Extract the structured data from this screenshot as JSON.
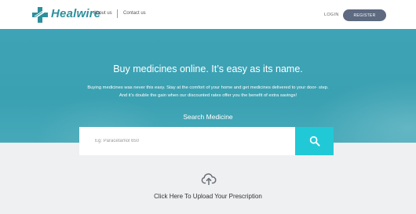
{
  "header": {
    "brand": "Healwire",
    "nav": {
      "about": "About us",
      "contact": "Contact us"
    },
    "login": "LOGIN",
    "register": "REGISTER"
  },
  "hero": {
    "title": "Buy medicines online. It’s easy as its name.",
    "desc_line1": "Buying medicines was never this easy. Stay at the comfort of your home and get medicines delivered to your door- step.",
    "desc_line2": "And it’s double the gain when our discounted rates offer you the benefit of extra savings!",
    "search_label": "Search Medicine",
    "search_placeholder": "Eg: Paracetamol 650",
    "search_icon": "magnifier-icon"
  },
  "upload": {
    "icon": "cloud-upload-icon",
    "label": "Click Here To Upload Your Prescription"
  },
  "colors": {
    "brand": "#2d8f9c",
    "hero": "#3fa3b6",
    "search_button": "#21c9d6",
    "register_button": "#5d6a80"
  }
}
